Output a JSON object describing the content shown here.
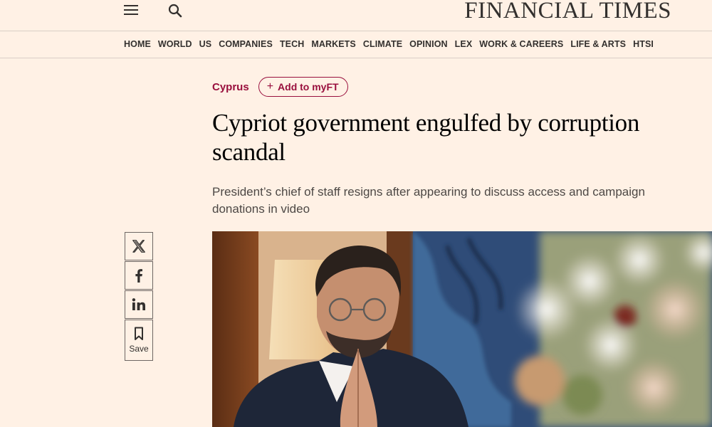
{
  "header": {
    "brand": "FINANCIAL TIMES",
    "menu_icon": "hamburger-menu-icon",
    "search_icon": "search-icon"
  },
  "nav": {
    "items": [
      "HOME",
      "WORLD",
      "US",
      "COMPANIES",
      "TECH",
      "MARKETS",
      "CLIMATE",
      "OPINION",
      "LEX",
      "WORK & CAREERS",
      "LIFE & ARTS",
      "HTSI"
    ]
  },
  "article": {
    "topic": "Cyprus",
    "add_myft_label": "Add to myFT",
    "headline": "Cypriot government engulfed by corruption scandal",
    "standfirst": "President’s chief of staff resigns after appearing to discuss access and campaign donations in video"
  },
  "share": {
    "items": [
      {
        "name": "x-share-button",
        "icon": "x-twitter-icon"
      },
      {
        "name": "facebook-share-button",
        "icon": "facebook-icon"
      },
      {
        "name": "linkedin-share-button",
        "icon": "linkedin-icon"
      }
    ],
    "save_label": "Save"
  },
  "colors": {
    "background": "#fff1e5",
    "accent": "#990f3d",
    "text": "#33302e"
  }
}
